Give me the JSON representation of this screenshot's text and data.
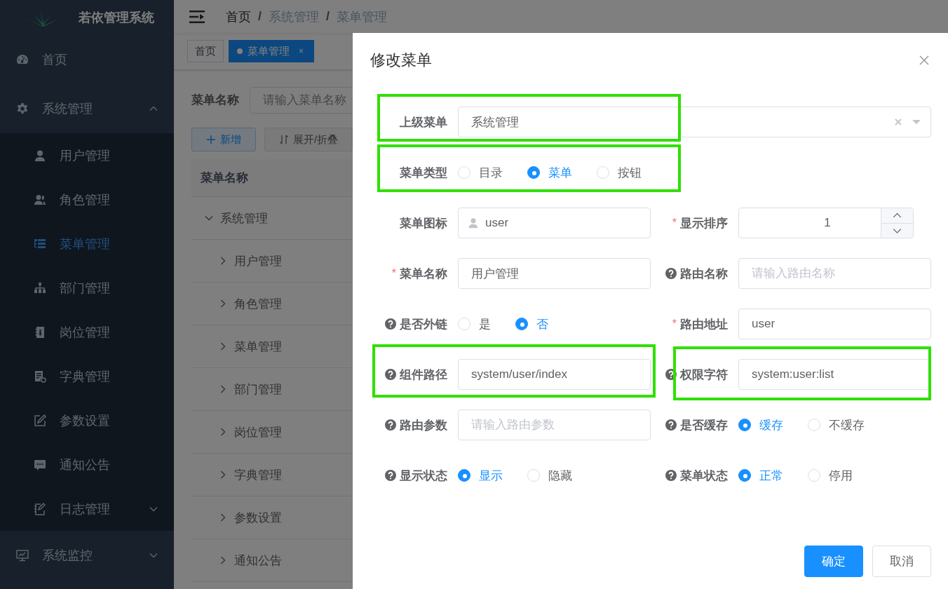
{
  "sidebar": {
    "title": "若依管理系统",
    "items": [
      {
        "label": "首页",
        "selected": false
      },
      {
        "label": "系统管理",
        "selected": false,
        "expanded": true,
        "children": [
          {
            "label": "用户管理",
            "selected": false
          },
          {
            "label": "角色管理",
            "selected": false
          },
          {
            "label": "菜单管理",
            "selected": true
          },
          {
            "label": "部门管理",
            "selected": false
          },
          {
            "label": "岗位管理",
            "selected": false
          },
          {
            "label": "字典管理",
            "selected": false
          },
          {
            "label": "参数设置",
            "selected": false
          },
          {
            "label": "通知公告",
            "selected": false
          },
          {
            "label": "日志管理",
            "selected": false,
            "expanded": false
          }
        ]
      },
      {
        "label": "系统监控",
        "selected": false,
        "expanded": false
      }
    ]
  },
  "breadcrumb": {
    "items": [
      "首页",
      "系统管理",
      "菜单管理"
    ],
    "separators": [
      "/",
      "/"
    ]
  },
  "tags": [
    {
      "label": "首页",
      "selected": false
    },
    {
      "label": "菜单管理",
      "selected": true,
      "close": "×"
    }
  ],
  "search": {
    "label": "菜单名称",
    "placeholder": "请输入菜单名称"
  },
  "toolbar": [
    {
      "label": "新增",
      "kind": "add"
    },
    {
      "label": "展开/折叠",
      "kind": "toggle"
    }
  ],
  "table": {
    "columns": [
      "菜单名称"
    ],
    "rows": [
      {
        "label": "系统管理",
        "expanded": true,
        "children": [
          {
            "label": "用户管理",
            "expanded": false
          },
          {
            "label": "角色管理",
            "expanded": false
          },
          {
            "label": "菜单管理",
            "expanded": false
          },
          {
            "label": "部门管理",
            "expanded": false
          },
          {
            "label": "岗位管理",
            "expanded": false
          },
          {
            "label": "字典管理",
            "expanded": false
          },
          {
            "label": "参数设置",
            "expanded": false
          },
          {
            "label": "通知公告",
            "expanded": false
          }
        ]
      }
    ]
  },
  "dialog": {
    "title": "修改菜单",
    "fields": [
      {
        "label": "上级菜单",
        "kind": "select",
        "wide": true,
        "highlighted": true,
        "value": "系统管理"
      },
      {
        "label": "菜单类型",
        "kind": "radio",
        "wide": true,
        "highlighted": true,
        "options": [
          {
            "label": "目录",
            "selected": false
          },
          {
            "label": "菜单",
            "selected": true
          },
          {
            "label": "按钮",
            "selected": false
          }
        ]
      },
      {
        "label": "菜单图标",
        "kind": "icon-input",
        "highlighted": false,
        "value": "user"
      },
      {
        "label": "显示排序",
        "kind": "number",
        "highlighted": false,
        "required_mark": "*",
        "value": "1"
      },
      {
        "label": "菜单名称",
        "kind": "input",
        "highlighted": false,
        "required_mark": "*",
        "value": "用户管理"
      },
      {
        "label": "路由名称",
        "kind": "input",
        "highlighted": false,
        "help": true,
        "placeholder": "请输入路由名称"
      },
      {
        "label": "是否外链",
        "kind": "radio",
        "highlighted": false,
        "help": true,
        "options": [
          {
            "label": "是",
            "selected": false
          },
          {
            "label": "否",
            "selected": true
          }
        ]
      },
      {
        "label": "路由地址",
        "kind": "input",
        "highlighted": false,
        "required_mark": "*",
        "value": "user"
      },
      {
        "label": "组件路径",
        "kind": "input",
        "highlighted": true,
        "help": true,
        "value": "system/user/index"
      },
      {
        "label": "权限字符",
        "kind": "input",
        "highlighted": true,
        "help": true,
        "value": "system:user:list"
      },
      {
        "label": "路由参数",
        "kind": "input",
        "highlighted": false,
        "help": true,
        "placeholder": "请输入路由参数"
      },
      {
        "label": "是否缓存",
        "kind": "radio",
        "highlighted": false,
        "help": true,
        "options": [
          {
            "label": "缓存",
            "selected": true
          },
          {
            "label": "不缓存",
            "selected": false
          }
        ]
      },
      {
        "label": "显示状态",
        "kind": "radio",
        "highlighted": false,
        "help": true,
        "options": [
          {
            "label": "显示",
            "selected": true
          },
          {
            "label": "隐藏",
            "selected": false
          }
        ]
      },
      {
        "label": "菜单状态",
        "kind": "radio",
        "highlighted": false,
        "help": true,
        "options": [
          {
            "label": "正常",
            "selected": true
          },
          {
            "label": "停用",
            "selected": false
          }
        ]
      }
    ],
    "buttons": [
      {
        "label": "确定",
        "kind": "primary"
      },
      {
        "label": "取消",
        "kind": "default"
      }
    ]
  }
}
